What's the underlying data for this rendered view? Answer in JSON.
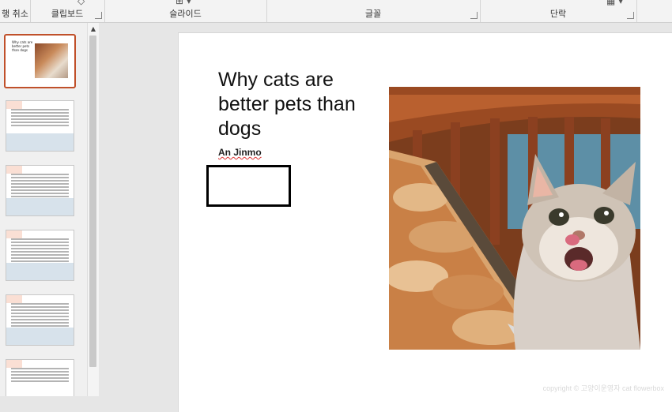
{
  "ribbon": {
    "undo_fragment": "행 취소",
    "clipboard_label": "클립보드",
    "slide_label": "슬라이드",
    "font_label": "글꼴",
    "paragraph_label": "단락"
  },
  "slides": [
    {
      "title": "Why cats are better pets than dogs",
      "selected": true
    },
    {
      "selected": false
    },
    {
      "selected": false
    },
    {
      "selected": false
    },
    {
      "selected": false
    },
    {
      "selected": false
    }
  ],
  "slide": {
    "title": "Why cats are better pets than dogs",
    "subtitle": "An Jinmo",
    "image_icon": "cat-photo"
  },
  "watermark": "copyright © 고양이운영자 cat flowerbox",
  "colors": {
    "selection": "#c0502a",
    "ribbon_bg": "#f3f3f3"
  }
}
